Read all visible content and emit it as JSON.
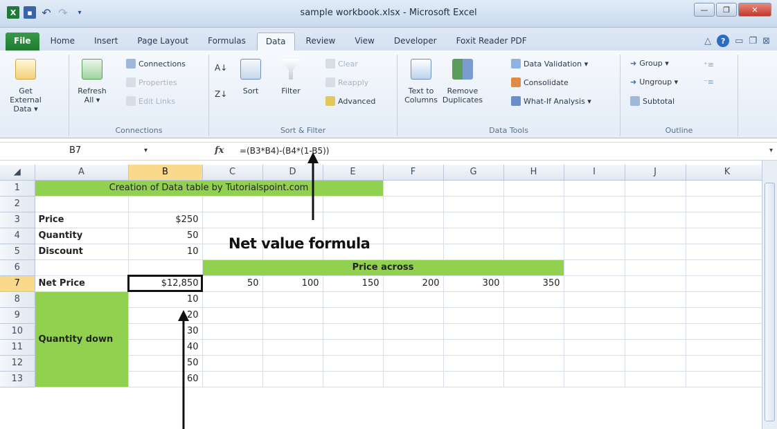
{
  "window": {
    "title": "sample workbook.xlsx - Microsoft Excel",
    "app_icon": "X"
  },
  "tabs": [
    "File",
    "Home",
    "Insert",
    "Page Layout",
    "Formulas",
    "Data",
    "Review",
    "View",
    "Developer",
    "Foxit Reader PDF"
  ],
  "active_tab": "Data",
  "ribbon": {
    "get_external_data": "Get External Data ▾",
    "refresh_all": "Refresh All ▾",
    "connections": "Connections",
    "properties": "Properties",
    "edit_links": "Edit Links",
    "group_connections": "Connections",
    "sort": "Sort",
    "filter": "Filter",
    "clear": "Clear",
    "reapply": "Reapply",
    "advanced": "Advanced",
    "group_sort_filter": "Sort & Filter",
    "text_to_columns": "Text to Columns",
    "remove_duplicates": "Remove Duplicates",
    "data_validation": "Data Validation ▾",
    "consolidate": "Consolidate",
    "what_if": "What-If Analysis ▾",
    "group_data_tools": "Data Tools",
    "group_btn": "Group ▾",
    "ungroup": "Ungroup ▾",
    "subtotal": "Subtotal",
    "group_outline": "Outline"
  },
  "formula_bar": {
    "name_box": "B7",
    "fx": "fx",
    "formula": "=(B3*B4)-(B4*(1-B5))"
  },
  "columns": [
    "A",
    "B",
    "C",
    "D",
    "E",
    "F",
    "G",
    "H",
    "I",
    "J",
    "K"
  ],
  "selected_column": "B",
  "selected_row": "7",
  "rows": [
    "1",
    "2",
    "3",
    "4",
    "5",
    "6",
    "7",
    "8",
    "9",
    "10",
    "11",
    "12",
    "13"
  ],
  "cells": {
    "title": "Creation of Data table by Tutorialspoint.com",
    "price_label": "Price",
    "price_value": "$250",
    "quantity_label": "Quantity",
    "quantity_value": "50",
    "discount_label": "Discount",
    "discount_value": "10",
    "price_across": "Price across",
    "net_price_label": "Net Price",
    "net_price_value": "$12,850",
    "price_across_values": [
      "50",
      "100",
      "150",
      "200",
      "300",
      "350"
    ],
    "quantity_down_label": "Quantity down",
    "quantity_down_values": [
      "10",
      "20",
      "30",
      "40",
      "50",
      "60"
    ]
  },
  "annotation": {
    "text": "Net value formula"
  },
  "colors": {
    "green_fill": "#92d050",
    "selection_header": "#f9d98a",
    "file_tab": "#1f7a30"
  }
}
